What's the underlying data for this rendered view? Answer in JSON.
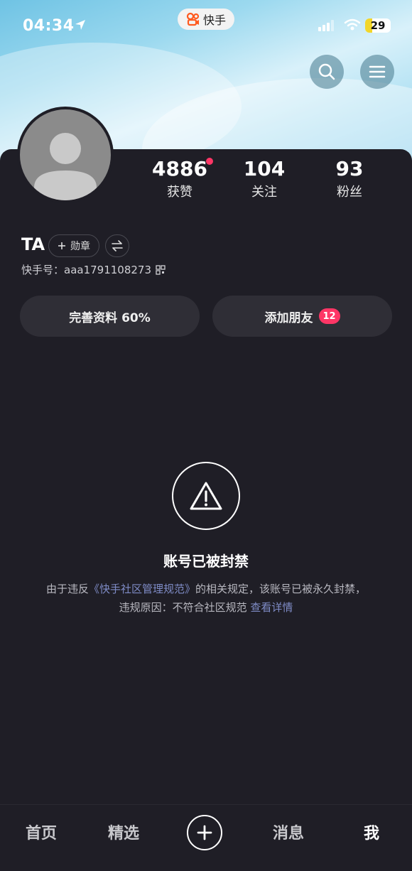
{
  "status_bar": {
    "time": "04:34",
    "app_name": "快手",
    "battery_level": "29"
  },
  "profile": {
    "name": "TA",
    "badge_button_label": "勋章",
    "account_id": "快手号：aaa1791108273",
    "stats": [
      {
        "value": "4886",
        "label": "获赞"
      },
      {
        "value": "104",
        "label": "关注"
      },
      {
        "value": "93",
        "label": "粉丝"
      }
    ]
  },
  "actions": {
    "complete_profile_label": "完善资料 60%",
    "add_friend_label": "添加朋友",
    "add_friend_count": "12"
  },
  "ban_notice": {
    "title": "账号已被封禁",
    "desc_prefix": "由于违反",
    "desc_link": "《快手社区管理规范》",
    "desc_middle": "的相关规定，该账号已被永久封禁，违规原因：不符合社区规范",
    "detail_link": "查看详情"
  },
  "tabbar": {
    "home": "首页",
    "featured": "精选",
    "messages": "消息",
    "me": "我"
  },
  "icons": [
    "location-arrow-icon",
    "kuaishou-logo-icon",
    "signal-icon",
    "wifi-icon",
    "search-icon",
    "menu-icon",
    "avatar-placeholder-icon",
    "plus-icon",
    "switch-icon",
    "qr-code-icon",
    "warning-icon",
    "create-plus-icon"
  ],
  "colors": {
    "accent": "#fe3666",
    "link": "#7f8cc7",
    "background": "#1f1e26",
    "battery": "#f2d62a"
  }
}
